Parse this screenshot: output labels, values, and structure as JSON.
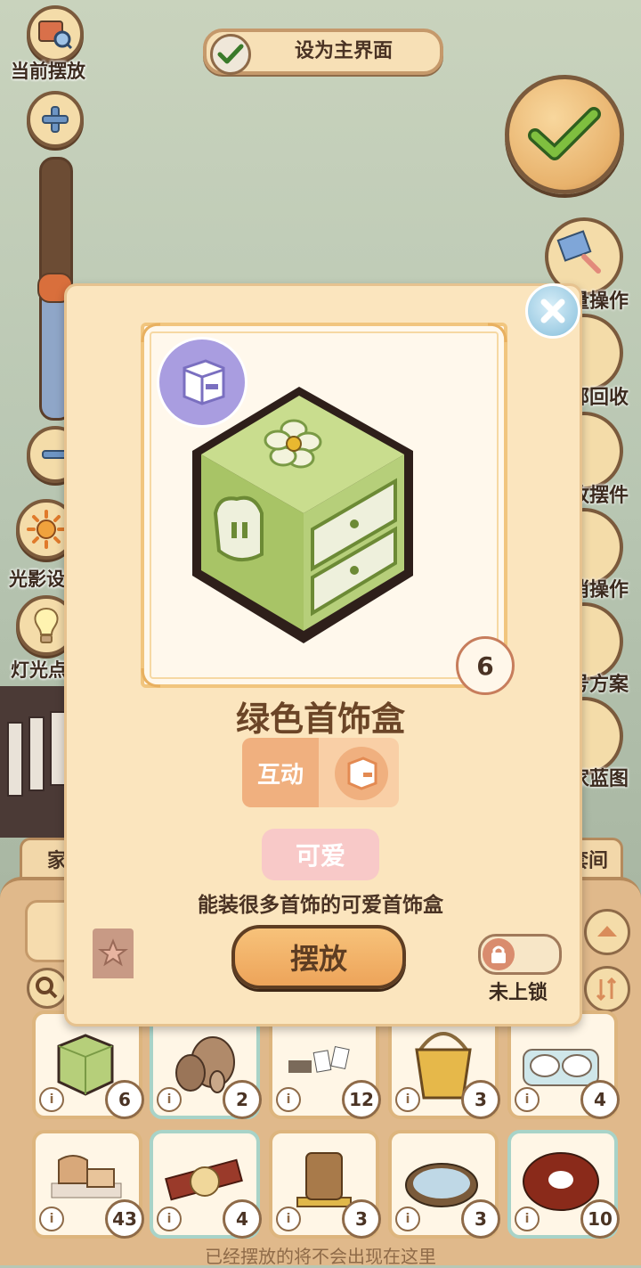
{
  "left_panel": {
    "current_placement_label": "当前摆放",
    "light_shadow_label": "光影设",
    "lamp_label": "灯光点",
    "zoom_slider_level": 0.5
  },
  "top_bar": {
    "set_home_label": "设为主界面",
    "set_home_checked": true
  },
  "right_panel": {
    "labels": [
      "量操作",
      "部回收",
      "收摆件",
      "消操作",
      "号方案",
      "家蓝图"
    ]
  },
  "modal": {
    "item_name": "绿色首饰盒",
    "count": "6",
    "interaction_label": "互动",
    "tag_label": "可爱",
    "description": "能装很多首饰的可爱首饰盒",
    "place_button": "摆放",
    "lock_label": "未上锁"
  },
  "bottom": {
    "tabs": [
      "家具",
      "套间"
    ],
    "grid_counts": [
      "6",
      "2",
      "12",
      "3",
      "4",
      "43",
      "4",
      "3",
      "3",
      "10"
    ],
    "info_glyph": "i",
    "footer_note": "已经摆放的将不会出现在这里"
  },
  "colors": {
    "panel_bg": "#fbe5be",
    "accent_orange": "#eda45a",
    "brown_outline": "#5e3d22",
    "tag_pink": "#f8c9c8",
    "type_badge_purple": "#a99de0",
    "item_green": "#b6cf7a"
  }
}
